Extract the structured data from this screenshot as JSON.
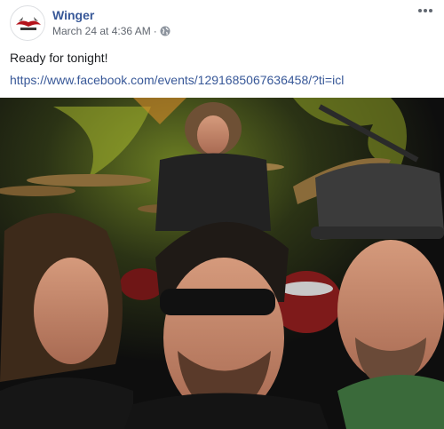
{
  "post": {
    "author": "Winger",
    "timestamp": "March 24 at 4:36 AM",
    "separator": "·",
    "privacy_icon": "globe-icon",
    "text": "Ready for tonight!",
    "link": "https://www.facebook.com/events/1291685067636458/?ti=icl",
    "more_icon": "more-options-icon"
  },
  "avatar": {
    "logo_text": "WINGER"
  },
  "colors": {
    "link": "#385898",
    "meta": "#616770",
    "text": "#1c1e21"
  }
}
